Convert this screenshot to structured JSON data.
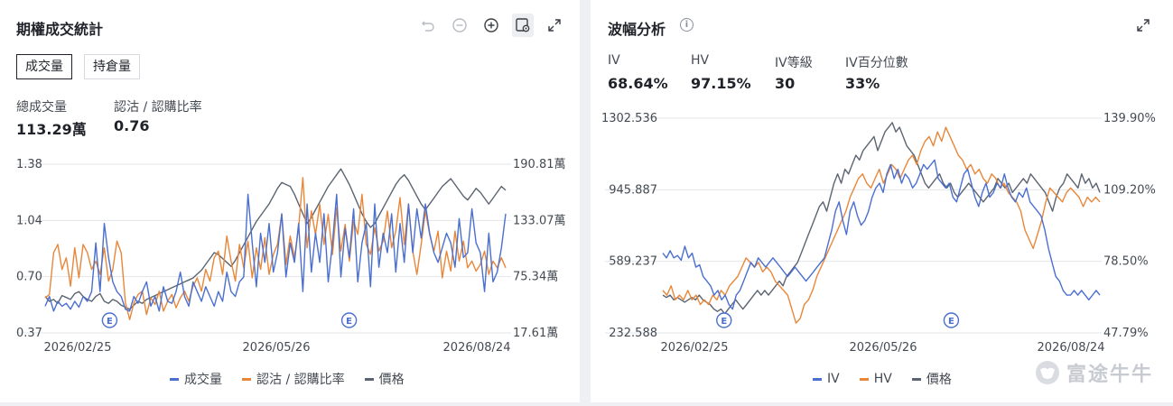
{
  "left": {
    "title": "期權成交統計",
    "tabs": [
      {
        "label": "成交量",
        "active": true
      },
      {
        "label": "持倉量",
        "active": false
      }
    ],
    "metrics": [
      {
        "label": "總成交量",
        "value": "113.29萬"
      },
      {
        "label": "認沽 / 認購比率",
        "value": "0.76"
      }
    ],
    "tools": [
      "undo-icon",
      "zoom-out-icon",
      "zoom-in-icon",
      "chart-settings-icon",
      "expand-icon"
    ]
  },
  "right": {
    "title": "波幅分析",
    "info_icon": "i",
    "metrics": [
      {
        "label": "IV",
        "value": "68.64%"
      },
      {
        "label": "HV",
        "value": "97.15%"
      },
      {
        "label": "IV等級",
        "value": "30"
      },
      {
        "label": "IV百分位數",
        "value": "33%"
      }
    ],
    "tools": [
      "expand-icon"
    ]
  },
  "watermark": "富途牛牛",
  "colors": {
    "blue": "#4a6fcf",
    "orange": "#e8873a",
    "gray": "#5b6470",
    "grid": "#e3e5e9",
    "earnings": "#4a6fcf"
  },
  "chart_data": [
    {
      "type": "line",
      "x_labels": [
        "2026/02/25",
        "2026/05/26",
        "2026/08/24"
      ],
      "left_axis": {
        "ticks": [
          "1.38",
          "1.04",
          "0.70",
          "0.37"
        ],
        "range": [
          0.37,
          1.38
        ]
      },
      "right_axis": {
        "ticks": [
          "190.81萬",
          "133.07萬",
          "75.34萬",
          "17.61萬"
        ],
        "range": [
          17.61,
          190.81
        ]
      },
      "earnings_markers": [
        {
          "label": "E",
          "position": 0.14
        },
        {
          "label": "E",
          "position": 0.66
        }
      ],
      "series": [
        {
          "name": "成交量",
          "axis": "right",
          "color": "#4a6fcf",
          "values": [
            45,
            55,
            40,
            50,
            45,
            48,
            42,
            50,
            44,
            55,
            50,
            60,
            110,
            60,
            130,
            95,
            70,
            60,
            55,
            42,
            40,
            55,
            48,
            60,
            70,
            45,
            55,
            40,
            65,
            50,
            48,
            60,
            80,
            55,
            45,
            70,
            60,
            50,
            65,
            55,
            45,
            60,
            50,
            80,
            60,
            55,
            70,
            75,
            160,
            110,
            65,
            120,
            90,
            130,
            80,
            100,
            140,
            75,
            110,
            90,
            130,
            60,
            150,
            80,
            120,
            90,
            140,
            70,
            110,
            160,
            75,
            125,
            95,
            145,
            70,
            110,
            130,
            65,
            150,
            85,
            120,
            100,
            140,
            80,
            130,
            90,
            150,
            100,
            145,
            115,
            150,
            120,
            100,
            90,
            105,
            120,
            110,
            85,
            135,
            95,
            100,
            145,
            110,
            100,
            60,
            120,
            70,
            80,
            105,
            140
          ]
        },
        {
          "name": "認沽 / 認購比率",
          "axis": "left",
          "color": "#e8873a",
          "values": [
            0.58,
            0.6,
            0.85,
            0.9,
            0.75,
            0.82,
            0.65,
            0.88,
            0.7,
            0.9,
            0.85,
            0.75,
            0.8,
            0.72,
            0.88,
            0.68,
            0.75,
            0.92,
            0.85,
            0.55,
            0.45,
            0.55,
            0.6,
            0.62,
            0.48,
            0.58,
            0.54,
            0.62,
            0.5,
            0.56,
            0.6,
            0.52,
            0.58,
            0.62,
            0.56,
            0.65,
            0.7,
            0.62,
            0.75,
            0.68,
            0.82,
            0.86,
            0.72,
            0.95,
            0.8,
            0.68,
            0.9,
            0.76,
            0.92,
            0.7,
            0.88,
            0.75,
            0.94,
            0.72,
            0.84,
            0.9,
            1.08,
            0.78,
            0.95,
            0.82,
            1.0,
            1.3,
            0.88,
            1.1,
            0.96,
            1.14,
            0.9,
            1.08,
            0.84,
            1.12,
            0.86,
            1.02,
            0.8,
            1.04,
            0.96,
            1.2,
            0.9,
            0.84,
            1.0,
            0.86,
            0.92,
            1.1,
            0.88,
            0.98,
            1.18,
            0.9,
            1.14,
            0.86,
            0.72,
            0.9,
            1.1,
            0.96,
            0.86,
            0.98,
            0.7,
            0.86,
            0.74,
            0.98,
            0.8,
            0.92,
            0.76,
            0.8,
            0.74,
            0.78,
            0.86,
            0.72,
            0.8,
            0.76,
            0.82,
            0.76
          ]
        },
        {
          "name": "價格",
          "axis": "right",
          "color": "#5b6470",
          "values": [
            55,
            50,
            52,
            48,
            56,
            54,
            52,
            58,
            60,
            55,
            52,
            50,
            55,
            58,
            50,
            48,
            52,
            50,
            46,
            44,
            42,
            46,
            50,
            48,
            52,
            54,
            56,
            58,
            60,
            62,
            64,
            66,
            68,
            70,
            72,
            74,
            78,
            82,
            88,
            94,
            100,
            98,
            94,
            90,
            86,
            92,
            100,
            108,
            116,
            124,
            132,
            138,
            144,
            150,
            158,
            166,
            172,
            170,
            168,
            160,
            150,
            140,
            130,
            136,
            144,
            152,
            160,
            168,
            174,
            180,
            186,
            178,
            170,
            160,
            150,
            140,
            132,
            126,
            130,
            138,
            146,
            154,
            162,
            170,
            176,
            180,
            174,
            166,
            158,
            150,
            144,
            150,
            156,
            162,
            168,
            172,
            176,
            170,
            164,
            158,
            154,
            160,
            166,
            162,
            156,
            150,
            156,
            162,
            168,
            164
          ]
        }
      ]
    },
    {
      "type": "line",
      "x_labels": [
        "2026/02/25",
        "2026/05/26",
        "2026/08/24"
      ],
      "left_axis": {
        "ticks": [
          "1302.536",
          "945.887",
          "589.237",
          "232.588"
        ],
        "range": [
          232.588,
          1302.536
        ]
      },
      "right_axis": {
        "ticks": [
          "139.90%",
          "109.20%",
          "78.50%",
          "47.79%"
        ],
        "range": [
          47.79,
          139.9
        ]
      },
      "earnings_markers": [
        {
          "label": "E",
          "position": 0.14
        },
        {
          "label": "E",
          "position": 0.66
        }
      ],
      "series": [
        {
          "name": "IV",
          "axis": "right",
          "color": "#4a6fcf",
          "values": [
            82,
            80,
            83,
            80,
            81,
            79,
            85,
            80,
            82,
            76,
            77,
            72,
            70,
            68,
            64,
            66,
            62,
            64,
            60,
            58,
            64,
            66,
            70,
            74,
            78,
            76,
            80,
            78,
            76,
            78,
            80,
            78,
            76,
            74,
            72,
            74,
            76,
            74,
            72,
            70,
            72,
            74,
            76,
            78,
            80,
            86,
            92,
            100,
            104,
            96,
            90,
            100,
            104,
            98,
            94,
            96,
            100,
            106,
            110,
            112,
            108,
            116,
            120,
            114,
            118,
            112,
            116,
            114,
            110,
            112,
            116,
            120,
            118,
            120,
            122,
            114,
            112,
            110,
            112,
            106,
            104,
            110,
            116,
            118,
            112,
            106,
            102,
            108,
            112,
            106,
            108,
            112,
            110,
            116,
            110,
            106,
            104,
            108,
            106,
            110,
            104,
            102,
            100,
            98,
            92,
            84,
            78,
            72,
            70,
            66,
            64,
            64,
            66,
            64,
            66,
            64,
            62,
            64,
            66,
            64
          ]
        },
        {
          "name": "HV",
          "axis": "right",
          "color": "#e8873a",
          "values": [
            66,
            64,
            68,
            62,
            64,
            62,
            66,
            62,
            64,
            60,
            62,
            60,
            64,
            62,
            66,
            64,
            68,
            70,
            72,
            76,
            80,
            78,
            76,
            78,
            74,
            76,
            74,
            70,
            68,
            66,
            64,
            58,
            52,
            54,
            60,
            62,
            66,
            72,
            76,
            80,
            84,
            88,
            92,
            96,
            100,
            106,
            110,
            114,
            116,
            112,
            110,
            114,
            118,
            112,
            116,
            120,
            118,
            114,
            118,
            122,
            124,
            120,
            126,
            130,
            132,
            128,
            134,
            130,
            136,
            132,
            128,
            124,
            122,
            118,
            120,
            116,
            118,
            114,
            112,
            116,
            114,
            110,
            112,
            108,
            106,
            104,
            100,
            92,
            88,
            84,
            90,
            96,
            104,
            110,
            108,
            106,
            104,
            108,
            110,
            108,
            106,
            102,
            106,
            104,
            106,
            104
          ]
        },
        {
          "name": "價格",
          "axis": "right",
          "color": "#5b6470",
          "values": [
            64,
            63,
            64,
            62,
            63,
            62,
            61,
            62,
            63,
            62,
            64,
            62,
            61,
            60,
            58,
            57,
            58,
            56,
            58,
            60,
            62,
            60,
            58,
            60,
            62,
            64,
            66,
            64,
            66,
            64,
            66,
            68,
            70,
            68,
            72,
            74,
            76,
            78,
            82,
            86,
            90,
            94,
            98,
            102,
            104,
            100,
            106,
            112,
            116,
            112,
            118,
            116,
            120,
            124,
            122,
            126,
            128,
            130,
            132,
            126,
            130,
            134,
            136,
            138,
            134,
            136,
            132,
            128,
            126,
            124,
            120,
            116,
            112,
            110,
            112,
            114,
            116,
            112,
            110,
            112,
            108,
            106,
            108,
            110,
            112,
            110,
            108,
            106,
            104,
            106,
            108,
            110,
            114,
            112,
            110,
            112,
            108,
            110,
            112,
            114,
            112,
            116,
            114,
            112,
            110,
            108,
            104,
            100,
            106,
            110,
            112,
            116,
            114,
            112,
            110,
            116,
            112,
            114,
            110,
            112,
            108
          ]
        }
      ]
    }
  ]
}
